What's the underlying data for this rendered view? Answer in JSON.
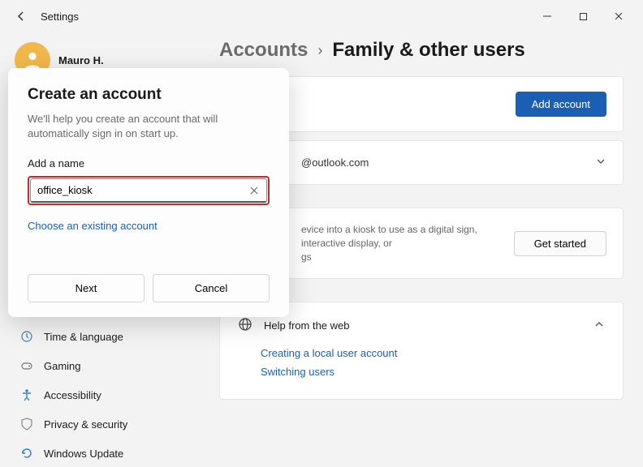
{
  "window": {
    "title": "Settings",
    "controls": {
      "minimize": "–",
      "maximize": "▢",
      "close": "✕"
    }
  },
  "profile": {
    "name": "Mauro H."
  },
  "sidebar": {
    "items": [
      {
        "label": "Time & language"
      },
      {
        "label": "Gaming"
      },
      {
        "label": "Accessibility"
      },
      {
        "label": "Privacy & security"
      },
      {
        "label": "Windows Update"
      }
    ]
  },
  "breadcrumb": {
    "parent": "Accounts",
    "separator": "›",
    "current": "Family & other users"
  },
  "panels": {
    "add_account_btn": "Add account",
    "outlook_text": "@outlook.com",
    "kiosk_desc": "evice into a kiosk to use as a digital sign, interactive display, or",
    "kiosk_desc2": "gs",
    "get_started_btn": "Get started"
  },
  "help": {
    "title": "Help from the web",
    "links": [
      "Creating a local user account",
      "Switching users"
    ]
  },
  "modal": {
    "title": "Create an account",
    "subtitle": "We'll help you create an account that will automatically sign in on start up.",
    "field_label": "Add a name",
    "input_value": "office_kiosk",
    "existing_link": "Choose an existing account",
    "next_btn": "Next",
    "cancel_btn": "Cancel"
  }
}
